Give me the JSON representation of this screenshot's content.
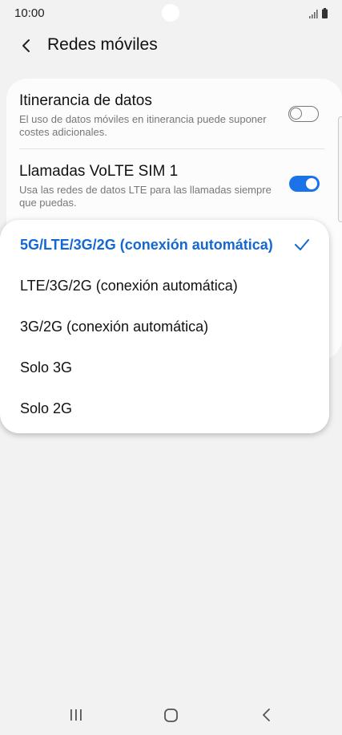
{
  "status_bar": {
    "time": "10:00",
    "icons": [
      "signal-icon",
      "battery-icon"
    ]
  },
  "header": {
    "title": "Redes móviles",
    "back_icon": "back-arrow-icon"
  },
  "settings": {
    "roaming": {
      "title": "Itinerancia de datos",
      "description": "El uso de datos móviles en itinerancia puede suponer costes adicionales.",
      "enabled": false
    },
    "volte": {
      "title": "Llamadas VoLTE SIM 1",
      "description": "Usa las redes de datos LTE para las llamadas siempre que puedas.",
      "enabled": true
    }
  },
  "network_mode_menu": {
    "options": [
      {
        "label": "5G/LTE/3G/2G (conexión automática)",
        "selected": true
      },
      {
        "label": "LTE/3G/2G (conexión automática)",
        "selected": false
      },
      {
        "label": "3G/2G (conexión automática)",
        "selected": false
      },
      {
        "label": "Solo 3G",
        "selected": false
      },
      {
        "label": "Solo 2G",
        "selected": false
      }
    ]
  },
  "nav_bar": {
    "icons": [
      "recent-apps-icon",
      "home-icon",
      "back-icon"
    ]
  },
  "colors": {
    "accent": "#1a73e8",
    "selected_text": "#1468d2",
    "background": "#f2f2f2",
    "card": "#fcfcfc"
  }
}
